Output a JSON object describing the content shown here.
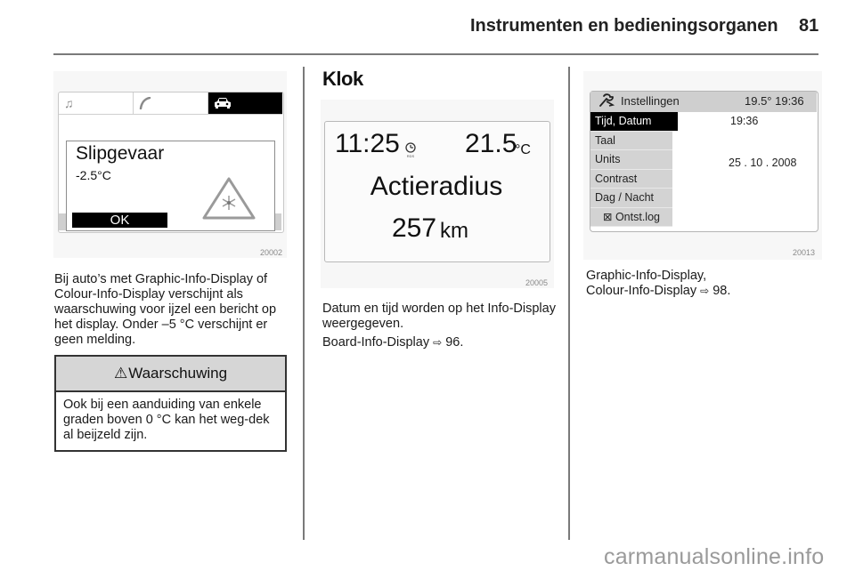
{
  "header": {
    "section_title": "Instrumenten en bedieningsorganen",
    "page_number": "81"
  },
  "figure_slip": {
    "tabs": [
      {
        "icon": "music-note-icon",
        "glyph": "♫",
        "active": false
      },
      {
        "icon": "phone-icon",
        "glyph": "✆",
        "active": false
      },
      {
        "icon": "car-icon",
        "glyph": "🚘",
        "active": true
      }
    ],
    "message_title": "Slipgevaar",
    "message_temp": "-2.5°C",
    "ok_label": "OK",
    "warning_symbol": "snowflake-warning-icon",
    "figure_id": "20002"
  },
  "col1": {
    "paragraph": "Bij auto’s met Graphic-Info-Display of Colour-Info-Display verschijnt als waarschuwing voor ijzel een bericht op het display. Onder –5 °C verschijnt er geen melding.",
    "warning": {
      "symbol": "⚠",
      "title": "Waarschuwing",
      "text": "Ook bij een aanduiding van enkele graden boven 0 °C kan het weg-dek al beijzeld zijn."
    }
  },
  "col2": {
    "heading": "Klok",
    "figure_clock": {
      "time": "11:25",
      "temperature": "21.5",
      "temperature_unit": "°C",
      "label": "Actieradius",
      "distance": "257",
      "distance_unit": "km",
      "figure_id": "20005"
    },
    "paragraph": "Datum en tijd worden op het Info-Display weergegeven.",
    "reference": {
      "text": "Board-Info-Display",
      "arrow": "⇨",
      "page": "96."
    }
  },
  "col3": {
    "figure_settings": {
      "title": "Instellingen",
      "status": "19.5°  19:36",
      "menu": [
        {
          "label": "Tijd, Datum",
          "active": true
        },
        {
          "label": "Taal",
          "active": false
        },
        {
          "label": "Units",
          "active": false
        },
        {
          "label": "Contrast",
          "active": false
        },
        {
          "label": "Dag / Nacht",
          "active": false
        },
        {
          "label": "⊠ Ontst.log",
          "active": false
        }
      ],
      "time_value": "19:36",
      "date_value": "25 . 10 . 2008",
      "figure_id": "20013"
    },
    "reference_line1": "Graphic-Info-Display,",
    "reference": {
      "text": "Colour-Info-Display",
      "arrow": "⇨",
      "page": "98."
    }
  },
  "watermark": "carmanualsonline.info"
}
